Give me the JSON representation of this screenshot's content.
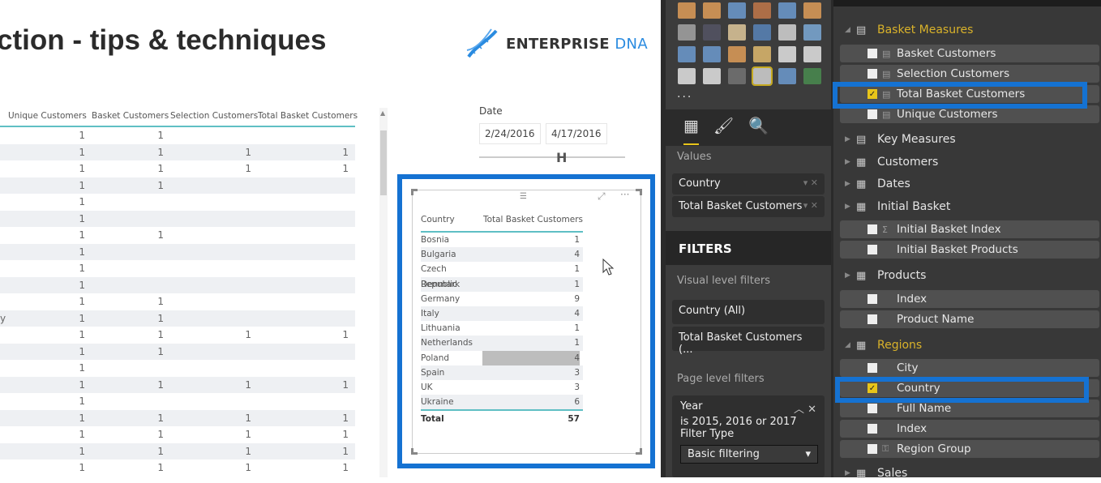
{
  "report": {
    "title": "ction - tips & techniques",
    "logo": {
      "brand": "ENTERPRISE",
      "brand_accent": "DNA",
      "color": "#2a8be0"
    },
    "main_table": {
      "columns": [
        "",
        "Unique Customers",
        "Basket Customers",
        "Selection Customers",
        "Total Basket Customers"
      ],
      "rows": [
        [
          "",
          "1",
          "1",
          "",
          ""
        ],
        [
          "",
          "1",
          "1",
          "1",
          "1"
        ],
        [
          "",
          "1",
          "1",
          "1",
          "1"
        ],
        [
          "",
          "1",
          "1",
          "",
          ""
        ],
        [
          "",
          "1",
          "",
          "",
          ""
        ],
        [
          "",
          "1",
          "",
          "",
          ""
        ],
        [
          "",
          "1",
          "1",
          "",
          ""
        ],
        [
          "",
          "1",
          "",
          "",
          ""
        ],
        [
          "",
          "1",
          "",
          "",
          ""
        ],
        [
          "",
          "1",
          "",
          "",
          ""
        ],
        [
          "",
          "1",
          "1",
          "",
          ""
        ],
        [
          "y",
          "1",
          "1",
          "",
          ""
        ],
        [
          "",
          "1",
          "1",
          "1",
          "1"
        ],
        [
          "",
          "1",
          "1",
          "",
          ""
        ],
        [
          "",
          "1",
          "",
          "",
          ""
        ],
        [
          "",
          "1",
          "1",
          "1",
          "1"
        ],
        [
          "",
          "1",
          "",
          "",
          ""
        ],
        [
          "",
          "1",
          "1",
          "1",
          "1"
        ],
        [
          "",
          "1",
          "1",
          "1",
          "1"
        ],
        [
          "",
          "1",
          "1",
          "1",
          "1"
        ],
        [
          "",
          "1",
          "1",
          "1",
          "1"
        ]
      ]
    },
    "date_slicer": {
      "label": "Date",
      "start": "2/24/2016",
      "end": "4/17/2016"
    },
    "selected_visual": {
      "columns": [
        "Country",
        "Total Basket Customers"
      ],
      "rows": [
        [
          "Bosnia",
          "1"
        ],
        [
          "Bulgaria",
          "4"
        ],
        [
          "Czech Republic",
          "1"
        ],
        [
          "Denmark",
          "1"
        ],
        [
          "Germany",
          "9"
        ],
        [
          "Italy",
          "4"
        ],
        [
          "Lithuania",
          "1"
        ],
        [
          "Netherlands",
          "1"
        ],
        [
          "Poland",
          "4"
        ],
        [
          "Spain",
          "3"
        ],
        [
          "UK",
          "3"
        ],
        [
          "Ukraine",
          "6"
        ]
      ],
      "hovered_row": "Poland",
      "total_label": "Total",
      "total_value": "57"
    },
    "highlight_color": "#1572d2"
  },
  "visualizations": {
    "more": "...",
    "selected_icon": "matrix-icon",
    "values_label": "Values",
    "values": [
      "Country",
      "Total Basket Customers"
    ],
    "filters_title": "FILTERS",
    "visual_level_label": "Visual level filters",
    "visual_filters": [
      "Country (All)",
      "Total Basket Customers (..."
    ],
    "page_level_label": "Page level filters",
    "year_filter": {
      "name": "Year",
      "condition": "is 2015, 2016 or 2017",
      "type_label": "Filter Type",
      "type_value": "Basic filtering"
    }
  },
  "fields": {
    "accent": "#d9b22a",
    "groups": [
      {
        "name": "Basket Measures",
        "open": true,
        "icon": "calculator-icon"
      },
      {
        "name": "Key Measures",
        "open": false,
        "icon": "calculator-icon"
      },
      {
        "name": "Customers",
        "open": false,
        "icon": "table-icon"
      },
      {
        "name": "Dates",
        "open": false,
        "icon": "table-icon"
      },
      {
        "name": "Initial Basket",
        "open": false,
        "icon": "table-icon"
      },
      {
        "name": "Products",
        "open": false,
        "icon": "table-icon"
      },
      {
        "name": "Regions",
        "open": true,
        "icon": "table-icon"
      },
      {
        "name": "Sales",
        "open": false,
        "icon": "table-icon"
      }
    ],
    "items": [
      {
        "name": "Basket Customers",
        "checked": false
      },
      {
        "name": "Selection Customers",
        "checked": false
      },
      {
        "name": "Total Basket Customers",
        "checked": true
      },
      {
        "name": "Unique Customers",
        "checked": false
      },
      {
        "name": "Initial Basket Index",
        "checked": false
      },
      {
        "name": "Initial Basket Products",
        "checked": false
      },
      {
        "name": "Index",
        "checked": false
      },
      {
        "name": "Product Name",
        "checked": false
      },
      {
        "name": "City",
        "checked": false
      },
      {
        "name": "Country",
        "checked": true
      },
      {
        "name": "Full Name",
        "checked": false
      },
      {
        "name": "Index",
        "checked": false
      },
      {
        "name": "Region Group",
        "checked": false
      }
    ]
  }
}
